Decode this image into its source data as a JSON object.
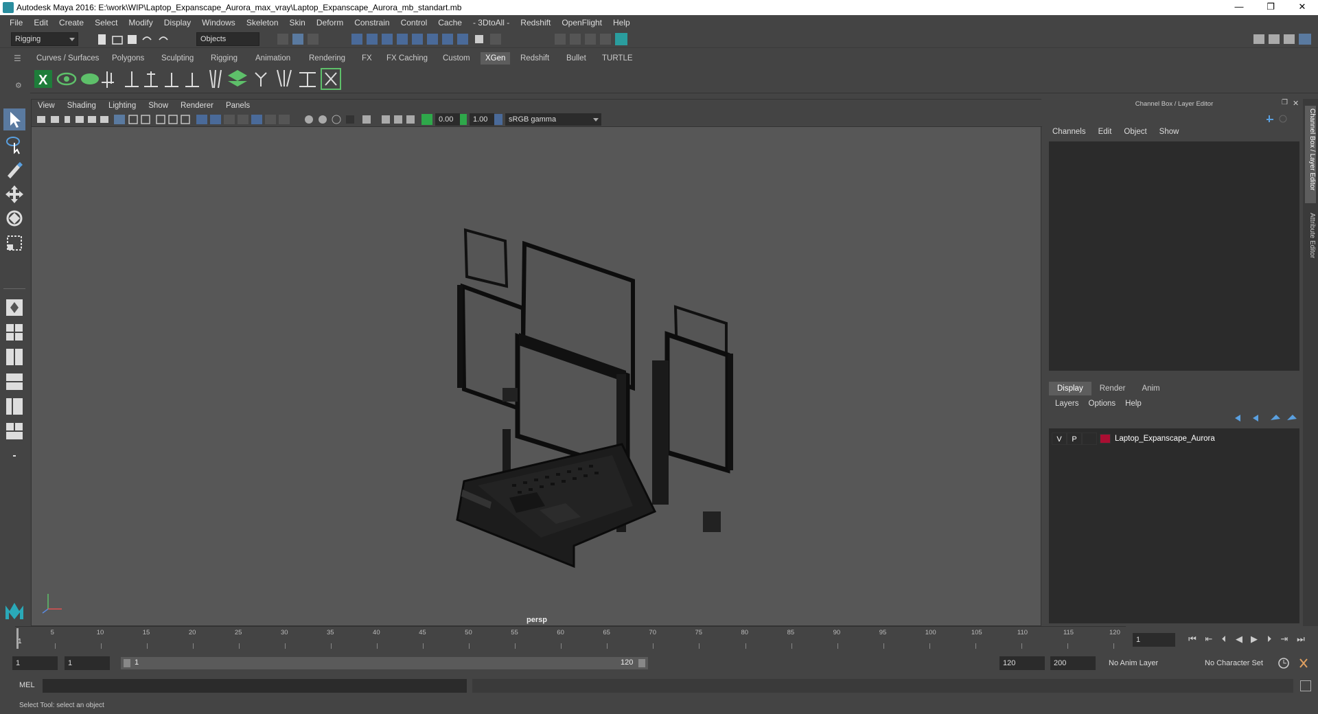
{
  "window": {
    "title": "Autodesk Maya 2016: E:\\work\\WIP\\Laptop_Expanscape_Aurora_max_vray\\Laptop_Expanscape_Aurora_mb_standart.mb",
    "minimize": "—",
    "restore": "❐",
    "close": "✕"
  },
  "menubar": [
    "File",
    "Edit",
    "Create",
    "Select",
    "Modify",
    "Display",
    "Windows",
    "Skeleton",
    "Skin",
    "Deform",
    "Constrain",
    "Control",
    "Cache",
    "- 3DtoAll -",
    "Redshift",
    "OpenFlight",
    "Help"
  ],
  "statusline": {
    "mode": "Rigging",
    "selection_mask": "Objects"
  },
  "shelf": {
    "tabs": [
      "Curves / Surfaces",
      "Polygons",
      "Sculpting",
      "Rigging",
      "Animation",
      "Rendering",
      "FX",
      "FX Caching",
      "Custom",
      "XGen",
      "Redshift",
      "Bullet",
      "TURTLE"
    ],
    "active_tab": "XGen"
  },
  "viewport": {
    "menus": [
      "View",
      "Shading",
      "Lighting",
      "Show",
      "Renderer",
      "Panels"
    ],
    "exposure": "0.00",
    "gamma": "1.00",
    "color_space": "sRGB gamma",
    "camera_label": "persp"
  },
  "channelbox": {
    "title": "Channel Box / Layer Editor",
    "menus": [
      "Channels",
      "Edit",
      "Object",
      "Show"
    ],
    "layer_tabs": [
      "Display",
      "Render",
      "Anim"
    ],
    "active_layer_tab": "Display",
    "layer_menus": [
      "Layers",
      "Options",
      "Help"
    ],
    "layer": {
      "visible": "V",
      "playback": "P",
      "name": "Laptop_Expanscape_Aurora",
      "color": "#aa0e32"
    }
  },
  "sidetabs": {
    "channel": "Channel Box / Layer Editor",
    "attr": "Attribute Editor"
  },
  "timeslider": {
    "ticks": [
      "5",
      "10",
      "15",
      "20",
      "25",
      "30",
      "35",
      "40",
      "45",
      "50",
      "55",
      "60",
      "65",
      "70",
      "75",
      "80",
      "85",
      "90",
      "95",
      "100",
      "105",
      "110",
      "115",
      "120"
    ],
    "start_label": "1",
    "current_frame": "1"
  },
  "range": {
    "start": "1",
    "playback_start": "1",
    "slider_start": "1",
    "slider_end": "120",
    "playback_end": "120",
    "end": "200",
    "anim_layer": "No Anim Layer",
    "character_set": "No Character Set"
  },
  "cmdline": {
    "label": "MEL"
  },
  "helpline": {
    "text": "Select Tool: select an object"
  }
}
